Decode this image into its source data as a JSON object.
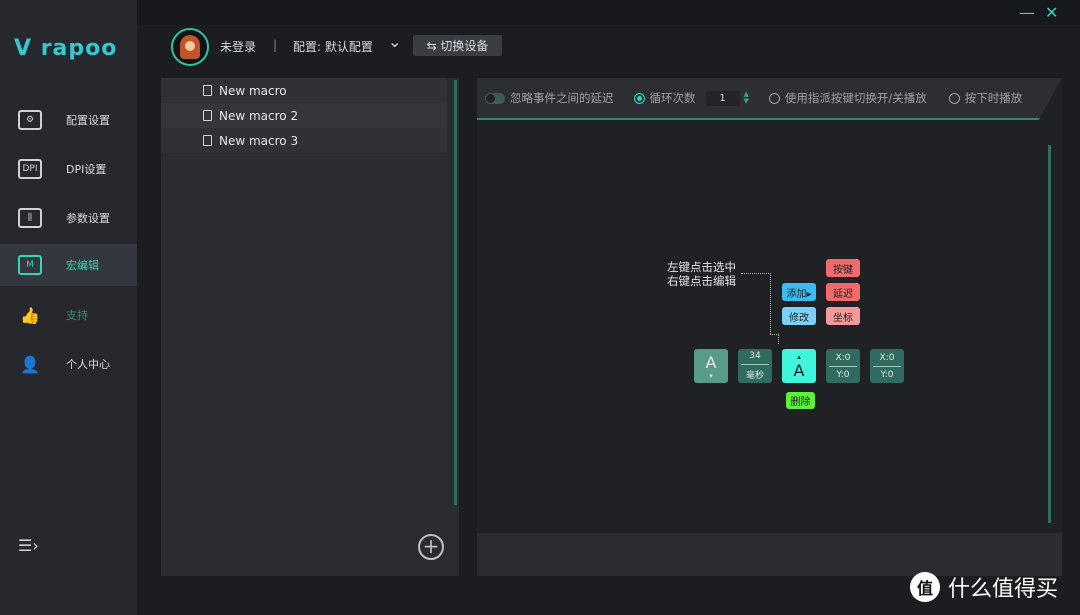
{
  "app": {
    "logo": "rapoo"
  },
  "sidebar": {
    "items": [
      {
        "label": "配置设置",
        "icon": "config-gear-icon",
        "glyph": "⚙"
      },
      {
        "label": "DPI设置",
        "icon": "dpi-icon",
        "glyph": "DPI"
      },
      {
        "label": "参数设置",
        "icon": "sliders-icon",
        "glyph": "⫼"
      },
      {
        "label": "宏编辑",
        "icon": "macro-icon",
        "glyph": "M",
        "active": true
      },
      {
        "label": "支持",
        "icon": "thumbs-up-icon",
        "glyph": "👍"
      },
      {
        "label": "个人中心",
        "icon": "user-icon",
        "glyph": "👤"
      }
    ],
    "collapse_glyph": "☰›"
  },
  "window": {
    "minimize": "—",
    "close": "✕"
  },
  "header": {
    "login_status": "未登录",
    "separator": "|",
    "profile": "配置: 默认配置",
    "dropdown": "⌄",
    "switch_device": "⇆ 切换设备"
  },
  "macros": {
    "items": [
      "New macro",
      "New macro 2",
      "New macro 3"
    ],
    "add": "+"
  },
  "toolbar": {
    "ignore_delay": "忽略事件之间的延迟",
    "loop_count_label": "循环次数",
    "loop_count": "1",
    "toggle_play": "使用指派按键切换开/关播放",
    "hold_play": "按下时播放"
  },
  "canvas": {
    "hint_line1": "左键点击选中",
    "hint_line2": "右键点击编辑",
    "add": "添加▸",
    "modify": "修改",
    "key": "按键",
    "delay": "延迟",
    "coord": "坐标",
    "delete": "删除",
    "events": [
      {
        "type": "key",
        "label": "A",
        "arrow": "▾"
      },
      {
        "type": "delay",
        "value": "34",
        "unit": "毫秒"
      },
      {
        "type": "key",
        "label": "A",
        "arrow": "▴",
        "selected": true
      },
      {
        "type": "coord",
        "x": "X:0",
        "y": "Y:0"
      },
      {
        "type": "coord",
        "x": "X:0",
        "y": "Y:0"
      }
    ]
  },
  "colors": {
    "accent": "#33d6b8",
    "red": "#f06b6b",
    "blue": "#3bbcf0",
    "green": "#5ff03c"
  },
  "watermark": {
    "icon": "值",
    "text": "什么值得买"
  }
}
